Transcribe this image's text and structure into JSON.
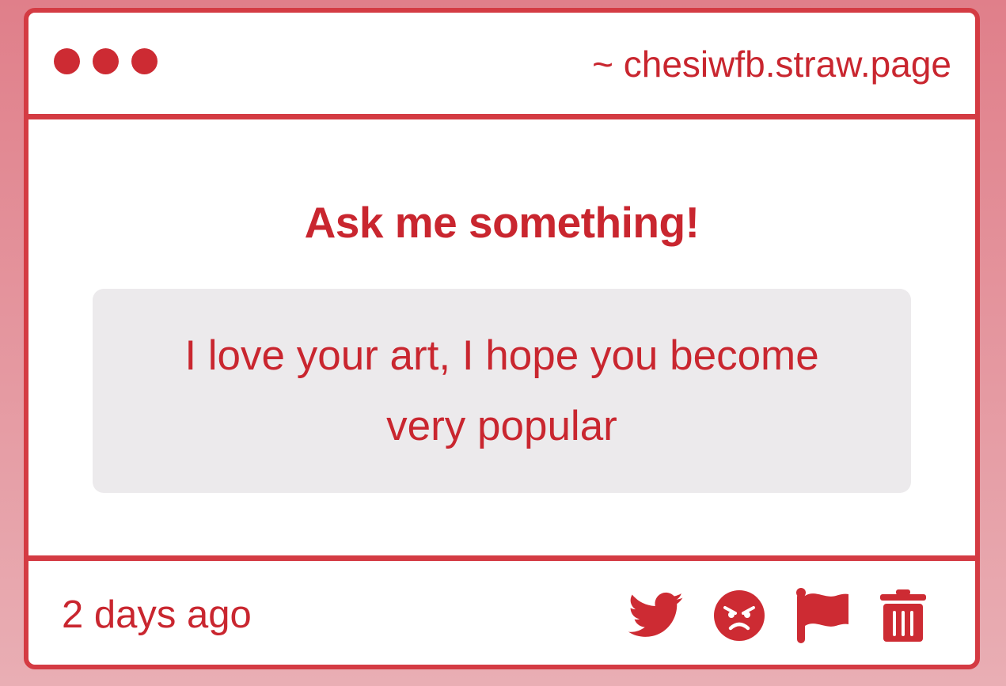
{
  "window": {
    "url": "~ chesiwfb.straw.page"
  },
  "main": {
    "heading": "Ask me something!",
    "question": "I love your art, I hope you become very popular"
  },
  "footer": {
    "timestamp": "2 days ago",
    "actions": [
      {
        "icon": "twitter-bird-icon"
      },
      {
        "icon": "angry-face-icon"
      },
      {
        "icon": "flag-icon"
      },
      {
        "icon": "trash-icon"
      }
    ]
  },
  "colors": {
    "accent": "#d43b43",
    "text": "#c9262f",
    "question_bg": "#eceaec",
    "background_top": "#e07f8a",
    "background_bottom": "#e9aeb4"
  }
}
